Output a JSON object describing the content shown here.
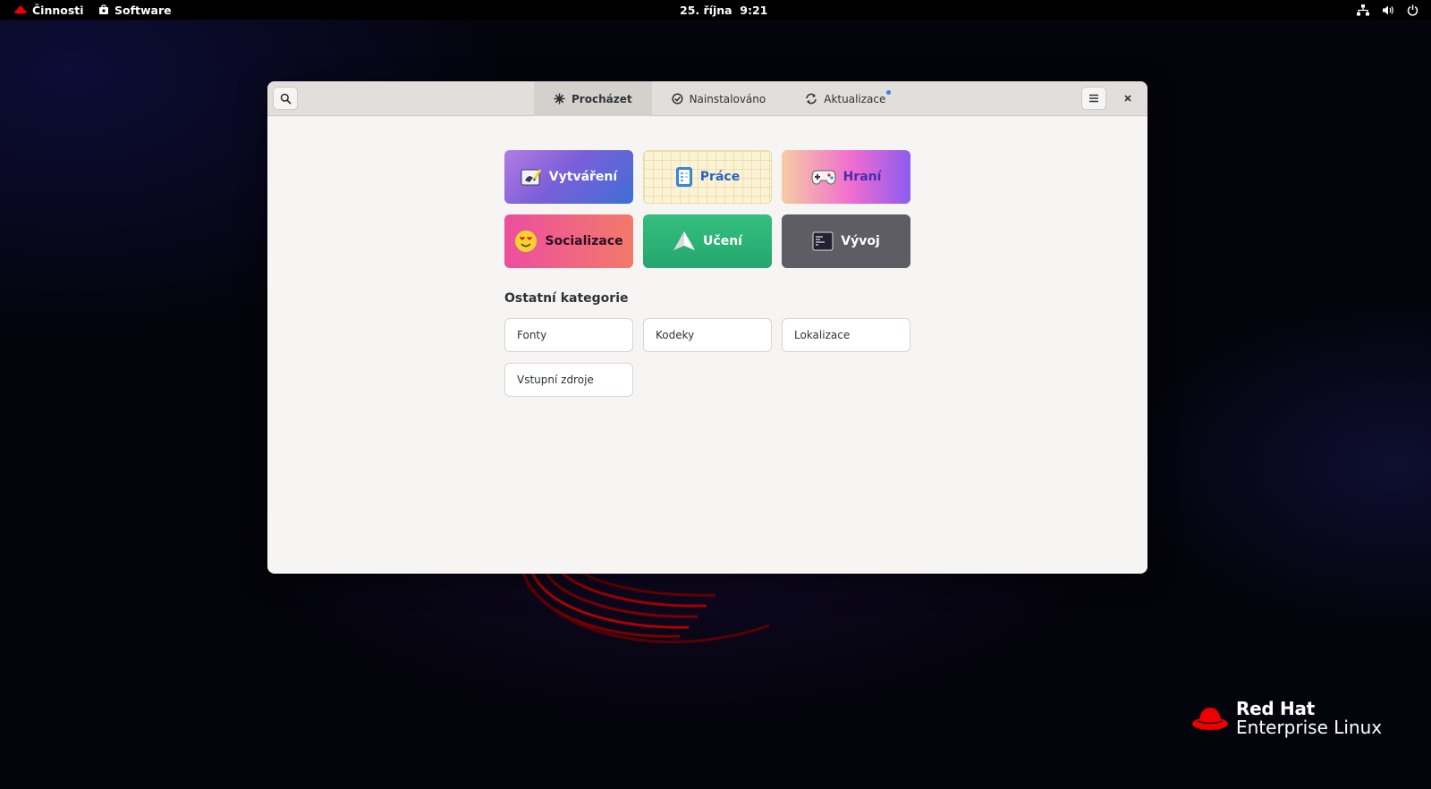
{
  "topbar": {
    "activities": "Činnosti",
    "app_name": "Software",
    "clock": "25. října  9:21",
    "status_icons": [
      "network-icon",
      "volume-icon",
      "power-icon"
    ]
  },
  "window": {
    "tabs": [
      {
        "label": "Procházet",
        "icon": "explore-icon",
        "active": true
      },
      {
        "label": "Nainstalováno",
        "icon": "installed-check-icon",
        "active": false
      },
      {
        "label": "Aktualizace",
        "icon": "refresh-icon",
        "active": false,
        "badge_dot": true
      }
    ],
    "buttons": {
      "search": "search-icon",
      "menu": "hamburger-menu-icon",
      "close": "close-icon"
    }
  },
  "featured_categories": [
    {
      "label": "Vytváření",
      "icon": "create-icon"
    },
    {
      "label": "Práce",
      "icon": "work-icon"
    },
    {
      "label": "Hraní",
      "icon": "gamepad-icon"
    },
    {
      "label": "Socializace",
      "icon": "smiley-icon"
    },
    {
      "label": "Učení",
      "icon": "paper-plane-icon"
    },
    {
      "label": "Vývoj",
      "icon": "terminal-icon"
    }
  ],
  "other_categories": {
    "title": "Ostatní kategorie",
    "items": [
      "Fonty",
      "Kodeky",
      "Lokalizace",
      "Vstupní zdroje"
    ]
  },
  "branding": {
    "line1": "Red Hat",
    "line2": "Enterprise Linux",
    "accent": "#ee0000"
  }
}
